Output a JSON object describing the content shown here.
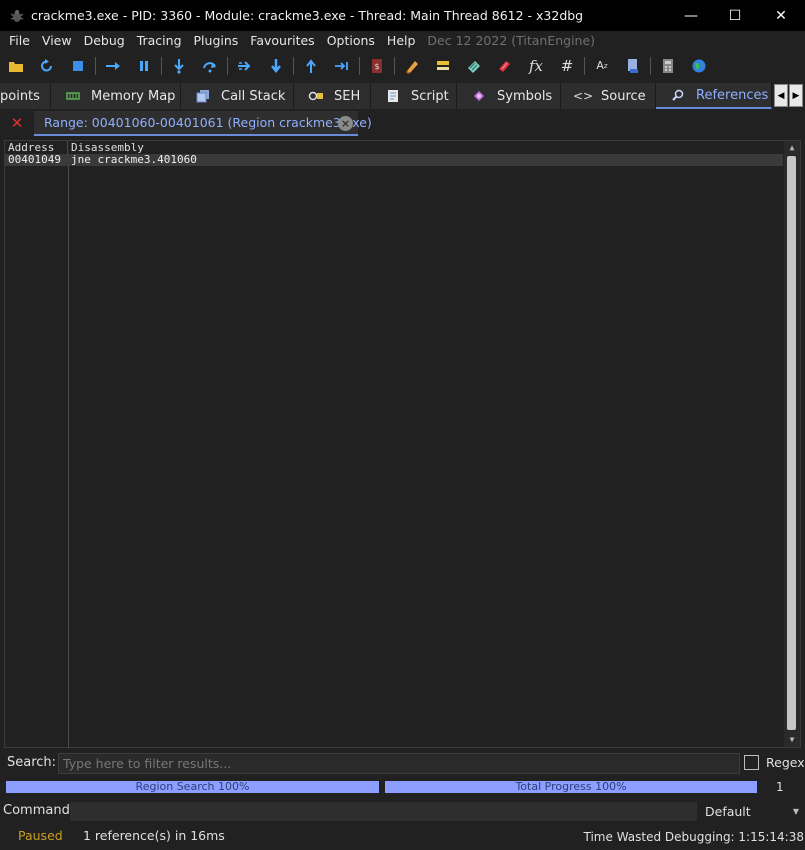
{
  "window": {
    "title": "crackme3.exe - PID: 3360 - Module: crackme3.exe - Thread: Main Thread 8612 - x32dbg",
    "minimize": "—",
    "maximize": "☐",
    "close": "✕"
  },
  "menu": {
    "items": [
      "File",
      "View",
      "Debug",
      "Tracing",
      "Plugins",
      "Favourites",
      "Options",
      "Help"
    ],
    "date": "Dec 12 2022 (TitanEngine)"
  },
  "tabs": {
    "items": [
      {
        "label": "points"
      },
      {
        "label": "Memory Map"
      },
      {
        "label": "Call Stack"
      },
      {
        "label": "SEH"
      },
      {
        "label": "Script"
      },
      {
        "label": "Symbols"
      },
      {
        "label": "Source"
      },
      {
        "label": "References"
      }
    ],
    "active": "References",
    "prev": "◀",
    "next": "▶"
  },
  "subtab": {
    "label": "Range: 00401060-00401061 (Region crackme3.exe)",
    "close": "×"
  },
  "table": {
    "columns": [
      "Address",
      "Disassembly"
    ],
    "rows": [
      {
        "address": "00401049",
        "disassembly": "jne crackme3.401060"
      }
    ]
  },
  "search": {
    "label": "Search:",
    "placeholder": "Type here to filter results...",
    "regex_label": "Regex"
  },
  "progress": {
    "region": {
      "label": "Region Search 100%",
      "value": 100
    },
    "total": {
      "label": "Total Progress 100%",
      "value": 100
    },
    "count": "1"
  },
  "command": {
    "label": "Command:",
    "value": "",
    "mode": "Default"
  },
  "status": {
    "state": "Paused",
    "message": "1 reference(s) in 16ms",
    "time": "Time Wasted Debugging: 1:15:14:38"
  },
  "colors": {
    "accent": "#8fb0ff",
    "progress": "#8c9eff",
    "paused": "#c8a020",
    "close_red": "#e03030"
  }
}
